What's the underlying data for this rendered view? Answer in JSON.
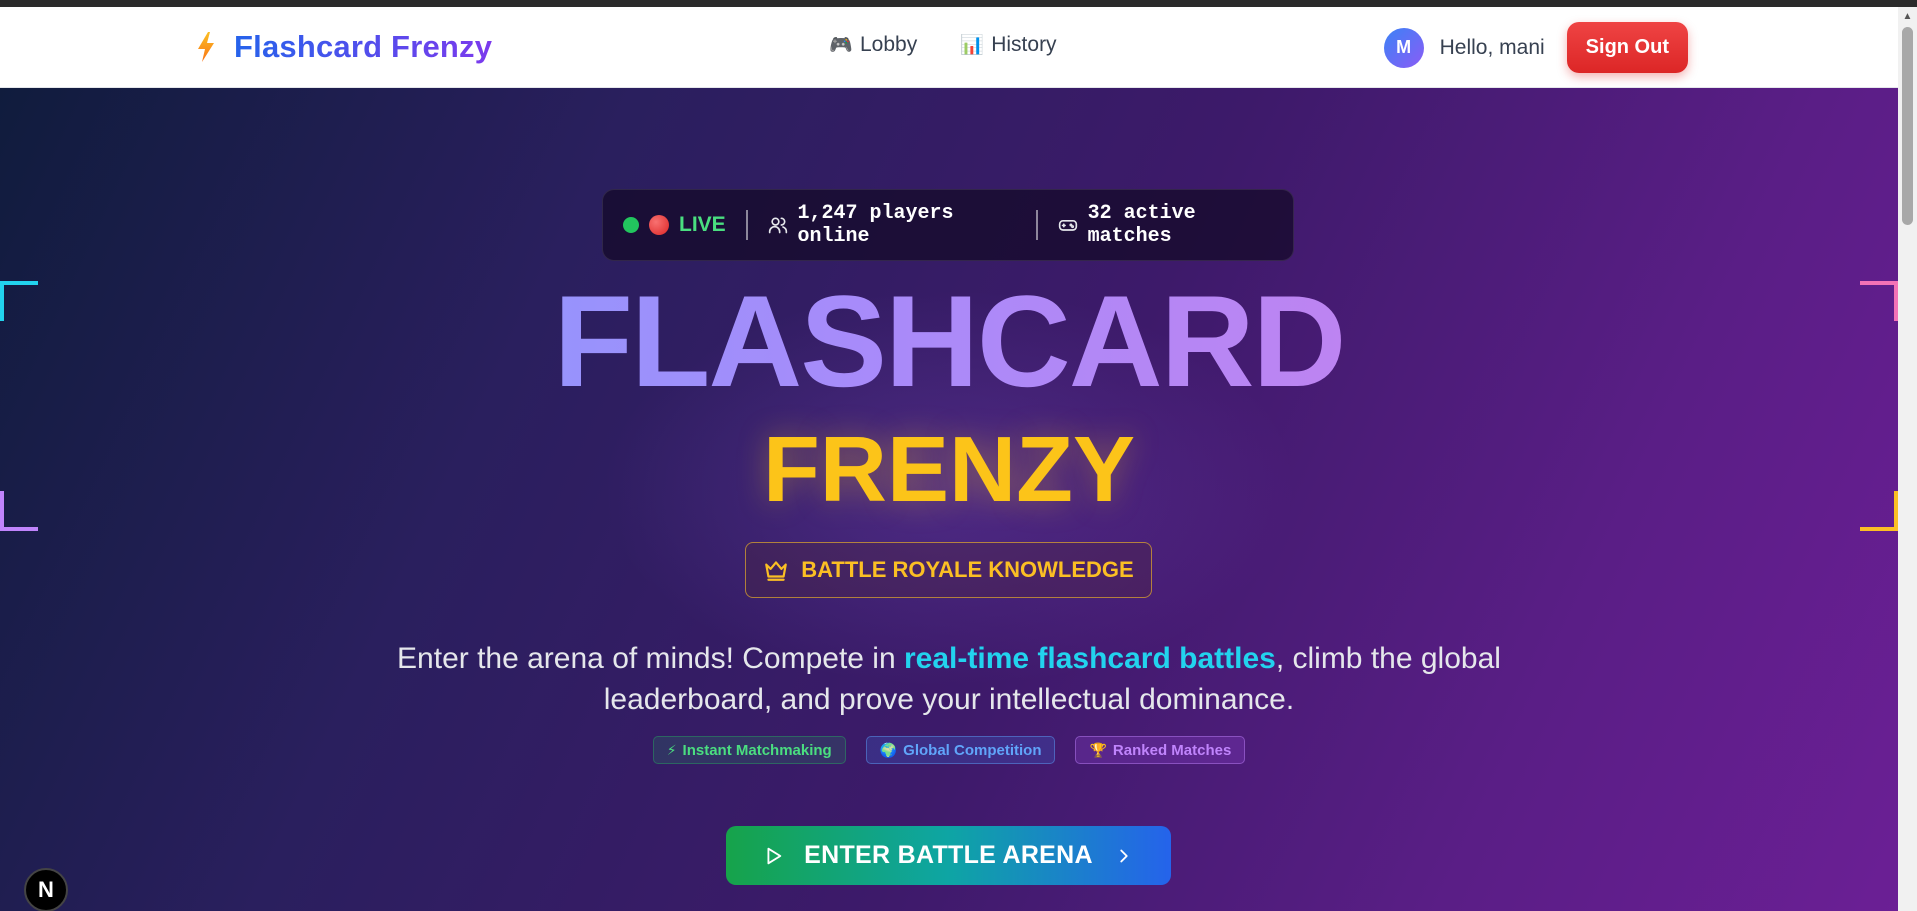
{
  "navbar": {
    "brand_name": "Flashcard Frenzy",
    "links": [
      {
        "label": "Lobby",
        "emoji": "🎮"
      },
      {
        "label": "History",
        "emoji": "📊"
      }
    ],
    "avatar_initial": "M",
    "greeting": "Hello, mani",
    "sign_out_label": "Sign Out"
  },
  "status": {
    "live_label": "LIVE",
    "players_online": "1,247 players online",
    "active_matches": "32 active matches"
  },
  "hero": {
    "title_main": "FLASHCARD",
    "title_sub": "FRENZY",
    "badge_label": "BATTLE ROYALE KNOWLEDGE",
    "tagline_before": "Enter the arena of minds! Compete in ",
    "tagline_highlight": "real-time flashcard battles",
    "tagline_after": ", climb the global leaderboard, and prove your intellectual dominance.",
    "chips": [
      {
        "label": "Instant Matchmaking",
        "emoji": "⚡"
      },
      {
        "label": "Global Competition",
        "emoji": "🌍"
      },
      {
        "label": "Ranked Matches",
        "emoji": "🏆"
      }
    ],
    "cta_label": "ENTER BATTLE ARENA"
  },
  "dev_badge": "N",
  "colors": {
    "brand_gradient_start": "#2563eb",
    "brand_gradient_end": "#7c3aed",
    "sign_out": "#ef4444",
    "live_green": "#22c55e",
    "title_sub": "#fcc419",
    "highlight": "#22d3ee",
    "badge_gold": "#fbbf24"
  },
  "icons": {
    "brand": "lightning-bolt-icon",
    "players": "users-icon",
    "matches": "gamepad-icon",
    "badge": "crown-icon",
    "cta_play": "play-icon",
    "cta_arrow": "chevron-right-icon"
  }
}
